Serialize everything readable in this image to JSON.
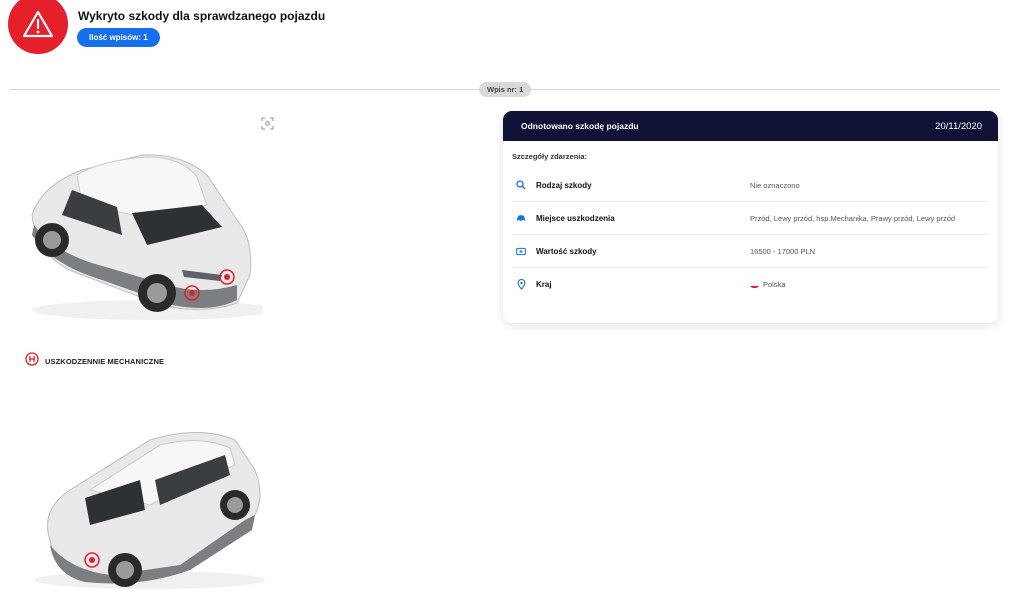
{
  "header": {
    "title": "Wykryto szkody dla sprawdzanego pojazdu",
    "count_label": "Ilość wpisów: 1",
    "alert_color": "#e5202a"
  },
  "entry": {
    "label": "Wpis nr: 1"
  },
  "damage_label": "USZKODZENNIE MECHANICZNE",
  "card": {
    "title": "Odnotowano szkodę pojazdu",
    "date": "20/11/2020",
    "subtitle": "Szczegóły zdarzenia:",
    "rows": [
      {
        "icon": "search-icon",
        "label": "Rodzaj szkody",
        "value": "Nie oznaczono"
      },
      {
        "icon": "car-icon",
        "label": "Miejsce uszkodzenia",
        "value": "Przód, Lewy przód, hsp.Mechanika, Prawy przód, Lewy przód"
      },
      {
        "icon": "money-icon",
        "label": "Wartość szkody",
        "value": "16500 - 17000 PLN"
      },
      {
        "icon": "location-pin-icon",
        "label": "Kraj",
        "value": "Polska"
      }
    ]
  },
  "colors": {
    "accent_blue": "#1570ef",
    "card_header": "#0f1136",
    "damage_red": "#e5202a"
  }
}
